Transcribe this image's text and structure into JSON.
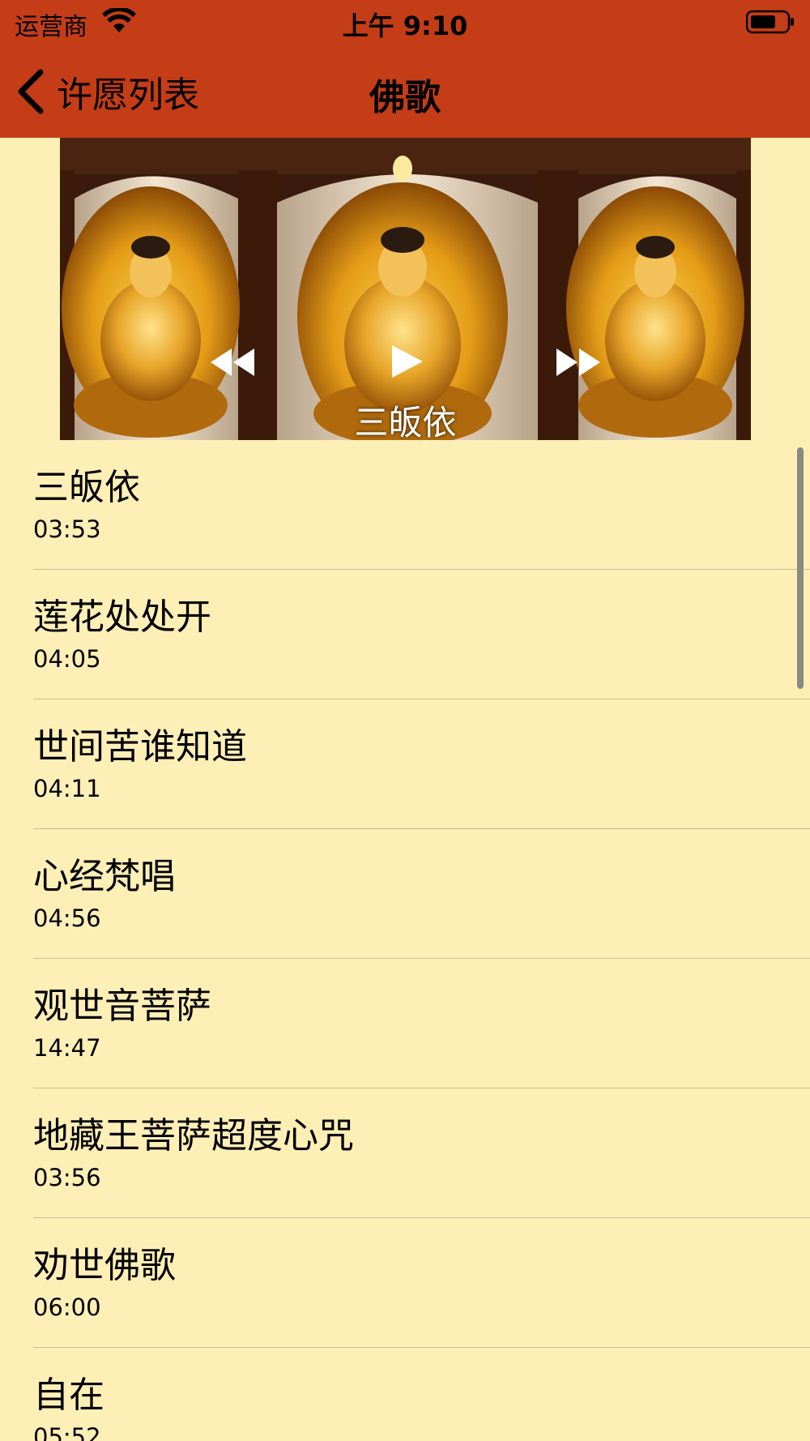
{
  "status_bar": {
    "carrier": "运营商",
    "time": "上午 9:10"
  },
  "nav": {
    "back_label": "许愿列表",
    "title": "佛歌"
  },
  "player": {
    "now_playing": "三皈依"
  },
  "songs": [
    {
      "title": "三皈依",
      "duration": "03:53"
    },
    {
      "title": "莲花处处开",
      "duration": "04:05"
    },
    {
      "title": "世间苦谁知道",
      "duration": "04:11"
    },
    {
      "title": "心经梵唱",
      "duration": "04:56"
    },
    {
      "title": "观世音菩萨",
      "duration": "14:47"
    },
    {
      "title": "地藏王菩萨超度心咒",
      "duration": "03:56"
    },
    {
      "title": "劝世佛歌",
      "duration": "06:00"
    },
    {
      "title": "自在",
      "duration": "05:52"
    }
  ],
  "colors": {
    "bar_background": "#c43d17",
    "list_background": "#fdefb6"
  }
}
